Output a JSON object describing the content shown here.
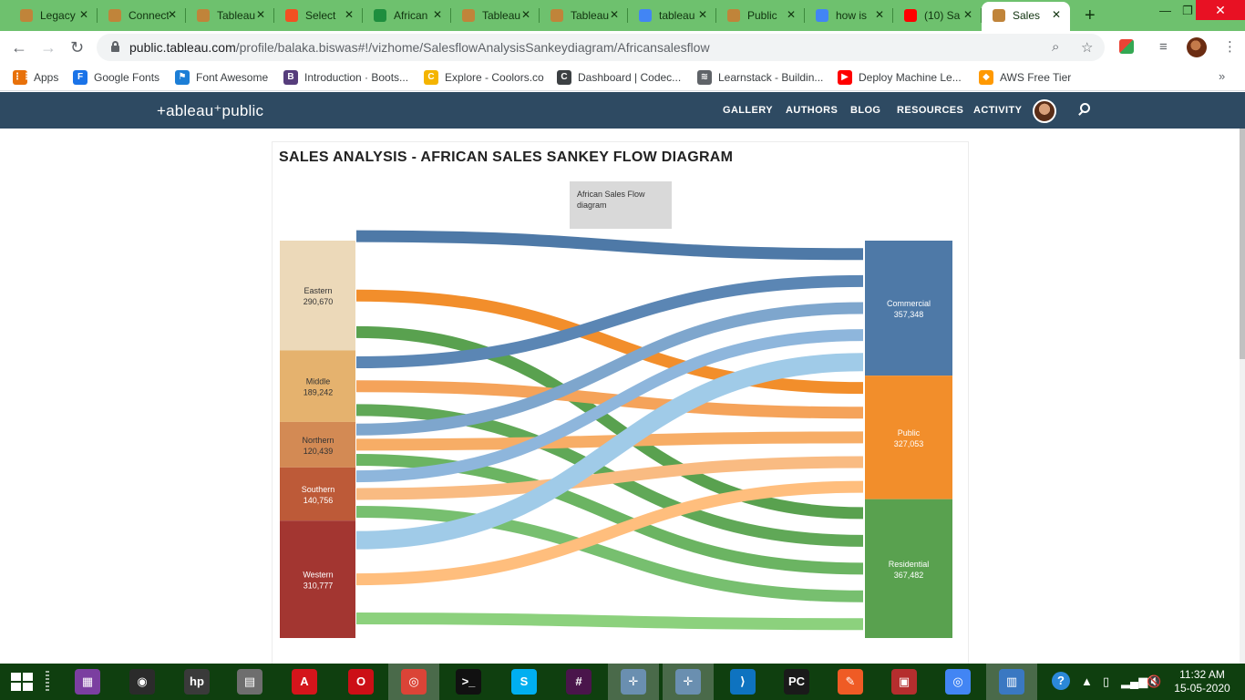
{
  "browser": {
    "tabs": [
      {
        "title": "Legacy",
        "icon": "tableau-icon",
        "color": "#c0843a"
      },
      {
        "title": "Connect",
        "icon": "tableau-icon",
        "color": "#c0843a"
      },
      {
        "title": "Tableau",
        "icon": "tableau-icon",
        "color": "#c0843a"
      },
      {
        "title": "Select",
        "icon": "microsoft-icon",
        "color": "#f25022"
      },
      {
        "title": "African",
        "icon": "sheets-icon",
        "color": "#1e8e3e"
      },
      {
        "title": "Tableau",
        "icon": "tableau-icon",
        "color": "#c0843a"
      },
      {
        "title": "Tableau",
        "icon": "tableau-icon",
        "color": "#c0843a"
      },
      {
        "title": "tableau",
        "icon": "google-icon",
        "color": "#4285f4"
      },
      {
        "title": "Public",
        "icon": "tableau-icon",
        "color": "#c0843a"
      },
      {
        "title": "how is",
        "icon": "google-icon",
        "color": "#4285f4"
      },
      {
        "title": "(10) Sa",
        "icon": "youtube-icon",
        "color": "#ff0000"
      },
      {
        "title": "Sales",
        "icon": "tableau-icon",
        "color": "#c0843a"
      }
    ],
    "url_host": "public.tableau.com",
    "url_path": "/profile/balaka.biswas#!/vizhome/SalesflowAnalysisSankeydiagram/Africansalesflow",
    "bookmarks": [
      {
        "label": "Apps",
        "icon": "apps-grid-icon",
        "color": "#e8710a",
        "glyph": "⋮⋮"
      },
      {
        "label": "Google Fonts",
        "icon": "google-fonts-icon",
        "color": "#1a73e8",
        "glyph": "F"
      },
      {
        "label": "Font Awesome",
        "icon": "font-awesome-icon",
        "color": "#1c7ed6",
        "glyph": "⚑"
      },
      {
        "label": "Introduction · Boots...",
        "icon": "bootstrap-icon",
        "color": "#563d7c",
        "glyph": "B"
      },
      {
        "label": "Explore - Coolors.co",
        "icon": "coolors-icon",
        "color": "#f4b400",
        "glyph": "C"
      },
      {
        "label": "Dashboard | Codec...",
        "icon": "codecademy-icon",
        "color": "#3c4043",
        "glyph": "C"
      },
      {
        "label": "Learnstack - Buildin...",
        "icon": "learnstack-icon",
        "color": "#5f6368",
        "glyph": "≋"
      },
      {
        "label": "Deploy Machine Le...",
        "icon": "youtube-icon",
        "color": "#ff0000",
        "glyph": "▶"
      },
      {
        "label": "AWS Free Tier",
        "icon": "aws-icon",
        "color": "#ff9900",
        "glyph": "◆"
      }
    ]
  },
  "tableau": {
    "logo": "+ableau⁺public",
    "nav": [
      "GALLERY",
      "AUTHORS",
      "BLOG",
      "RESOURCES",
      "ACTIVITY"
    ]
  },
  "viz": {
    "title": "SALES ANALYSIS - AFRICAN SALES SANKEY FLOW DIAGRAM",
    "caption": "African Sales Flow diagram"
  },
  "chart_data": {
    "type": "sankey",
    "sources": [
      {
        "name": "Eastern",
        "value": "290,670",
        "color": "#ecd9b9",
        "text_color": "#333333"
      },
      {
        "name": "Middle",
        "value": "189,242",
        "color": "#e5b26e",
        "text_color": "#333333"
      },
      {
        "name": "Northern",
        "value": "120,439",
        "color": "#d38a54",
        "text_color": "#333333"
      },
      {
        "name": "Southern",
        "value": "140,756",
        "color": "#bd5a38",
        "text_color": "#ffffff"
      },
      {
        "name": "Western",
        "value": "310,777",
        "color": "#a33631",
        "text_color": "#ffffff"
      }
    ],
    "targets": [
      {
        "name": "Commercial",
        "value": "357,348",
        "color": "#4e79a7"
      },
      {
        "name": "Public",
        "value": "327,053",
        "color": "#f28e2b"
      },
      {
        "name": "Residential",
        "value": "367,482",
        "color": "#59a14f"
      }
    ],
    "flow_colors": {
      "Commercial": [
        "#4e79a7",
        "#5b86b4",
        "#7ea6cd",
        "#8eb6dc",
        "#a0cbe8"
      ],
      "Public": [
        "#f28e2b",
        "#f5a35a",
        "#f7ad66",
        "#f9bb82",
        "#ffbe7d"
      ],
      "Residential": [
        "#59a14f",
        "#60a857",
        "#6bb462",
        "#77bf6f",
        "#8cd17d"
      ]
    }
  },
  "taskbar": {
    "time": "11:32 AM",
    "date": "15-05-2020",
    "apps": [
      {
        "icon": "winrar-icon",
        "color": "#7b3fa0",
        "glyph": "▦"
      },
      {
        "icon": "obs-icon",
        "color": "#2b2b2b",
        "glyph": "◉"
      },
      {
        "icon": "hp-icon",
        "color": "#3a3a3a",
        "glyph": "hp"
      },
      {
        "icon": "windows-features-icon",
        "color": "#6e6e6e",
        "glyph": "▤"
      },
      {
        "icon": "acrobat-icon",
        "color": "#d4151b",
        "glyph": "A"
      },
      {
        "icon": "opera-icon",
        "color": "#cc0f16",
        "glyph": "O"
      },
      {
        "icon": "chrome-icon",
        "color": "#db4437",
        "glyph": "◎"
      },
      {
        "icon": "terminal-icon",
        "color": "#111111",
        "glyph": ">_"
      },
      {
        "icon": "skype-icon",
        "color": "#00aff0",
        "glyph": "S"
      },
      {
        "icon": "slack-icon",
        "color": "#4a154b",
        "glyph": "#"
      },
      {
        "icon": "tableau-app-icon",
        "color": "#6a8fb0",
        "glyph": "✛"
      },
      {
        "icon": "tableau-public-app-icon",
        "color": "#6a8fb0",
        "glyph": "✛"
      },
      {
        "icon": "vscode-icon",
        "color": "#0e73c0",
        "glyph": "⟩"
      },
      {
        "icon": "pycharm-icon",
        "color": "#1a1a1a",
        "glyph": "PC"
      },
      {
        "icon": "postman-icon",
        "color": "#ef5b25",
        "glyph": "✎"
      },
      {
        "icon": "winforms-icon",
        "color": "#b52e2e",
        "glyph": "▣"
      },
      {
        "icon": "chrome-alt-icon",
        "color": "#4285f4",
        "glyph": "◎"
      },
      {
        "icon": "remote-desktop-icon",
        "color": "#3a78c2",
        "glyph": "▥"
      }
    ]
  }
}
